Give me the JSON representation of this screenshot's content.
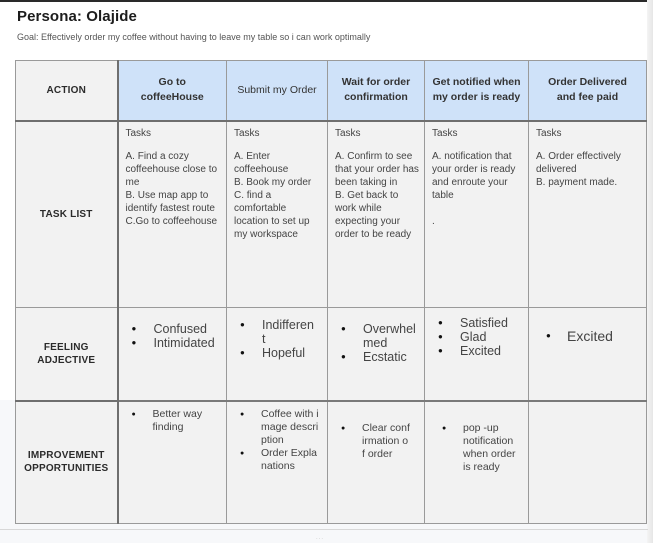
{
  "title": "Persona: Olajide",
  "goal": "Goal: Effectively order my coffee without having to leave my table so i can work optimally",
  "table": {
    "corner_label": "ACTION",
    "columns": [
      {
        "label": "Go to coffeeHouse"
      },
      {
        "label": "Submit my Order"
      },
      {
        "label": "Wait for order confirmation"
      },
      {
        "label": "Get notified when my order is ready"
      },
      {
        "label": "Order Delivered and fee paid"
      }
    ],
    "rows": {
      "task_list": {
        "label": "TASK LIST",
        "cells": [
          {
            "heading": "Tasks",
            "body": "A. Find a cozy coffeehouse close to me\nB. Use map app to identify fastest route\nC.Go to coffeehouse"
          },
          {
            "heading": "Tasks",
            "body": "A. Enter coffeehouse\nB. Book my order\nC. find a comfortable location to set up my workspace"
          },
          {
            "heading": "Tasks",
            "body": "A. Confirm to see that your order has been taking in\nB. Get back to work while expecting your order to be ready"
          },
          {
            "heading": "Tasks",
            "body": "A. notification that your order is ready and enroute your table\n\n."
          },
          {
            "heading": "Tasks",
            "body": "A. Order effectively delivered\nB. payment made."
          }
        ]
      },
      "feeling": {
        "label": "FEELING ADJECTIVE",
        "cells": [
          [
            "Confused",
            "Intimidated"
          ],
          [
            "Indifferent",
            "Hopeful"
          ],
          [
            "Overwhelmed",
            "Ecstatic"
          ],
          [
            "Satisfied",
            "Glad",
            "Excited"
          ],
          [
            "Excited"
          ]
        ]
      },
      "improvement": {
        "label": "IMPROVEMENT OPPORTUNITIES",
        "cells": [
          [
            "Better way finding"
          ],
          [
            "Coffee with image description",
            "Order Explanations"
          ],
          [
            "Clear confirmation of order"
          ],
          [
            "pop -up notification when order is ready"
          ],
          []
        ]
      }
    }
  },
  "footer": {
    "handle": "..."
  }
}
